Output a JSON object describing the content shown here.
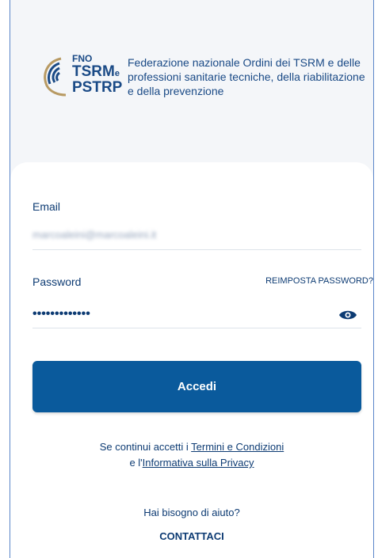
{
  "logo": {
    "fno": "FNO",
    "tsrm": "TSRM",
    "e": "e",
    "pstrp": "PSTRP"
  },
  "federation_name": "Federazione nazionale Ordini dei TSRM e delle professioni sanitarie tecniche, della riabilitazione e della prevenzione",
  "form": {
    "email_label": "Email",
    "email_value": "marcoaleini@marcoaleini.it",
    "password_label": "Password",
    "reset_password_link": "REIMPOSTA PASSWORD?",
    "password_value": "•••••••••••••",
    "submit_label": "Accedi"
  },
  "terms": {
    "prefix": "Se continui accetti i ",
    "terms_link": "Termini e Condizioni",
    "middle": "e l'",
    "privacy_link": "Informativa sulla Privacy"
  },
  "help": {
    "question": "Hai bisogno di aiuto?",
    "contact_link": "CONTATTACI"
  },
  "colors": {
    "primary": "#0a5a9c",
    "text": "#0d3b73",
    "logo_gold": "#b89a63"
  },
  "icons": {
    "password_toggle": "eye-icon"
  }
}
